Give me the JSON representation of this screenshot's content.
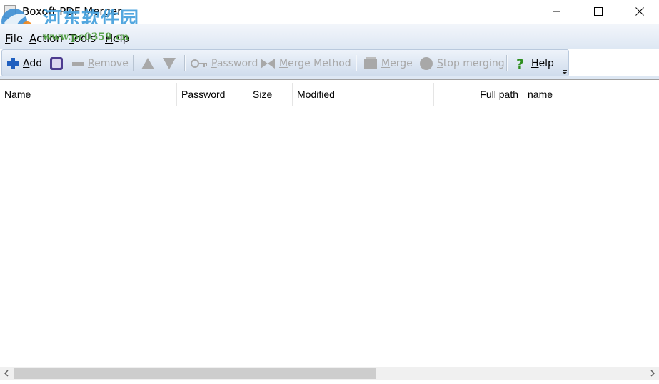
{
  "window": {
    "title": "Boxoft PDF Merger",
    "watermark_text": "河东软件园",
    "watermark_url": "www.pc0359.cn"
  },
  "menu": [
    {
      "label": "File"
    },
    {
      "label": "Action"
    },
    {
      "label": "Tools"
    },
    {
      "label": "Help"
    }
  ],
  "toolbar": {
    "add": "Add",
    "remove": "Remove",
    "password": "Password",
    "merge_method": "Merge Method",
    "merge": "Merge",
    "stop_merging": "Stop merging",
    "help": "Help"
  },
  "columns": [
    "Name",
    "Password",
    "Size",
    "Modified",
    "Full path",
    "name"
  ],
  "colors": {
    "add_icon": "#1f5fbf",
    "help_icon": "#2f8f1f",
    "disabled": "#a8a8a8",
    "toolbar_top": "#eef3fa",
    "toolbar_bottom": "#cfdcec"
  }
}
